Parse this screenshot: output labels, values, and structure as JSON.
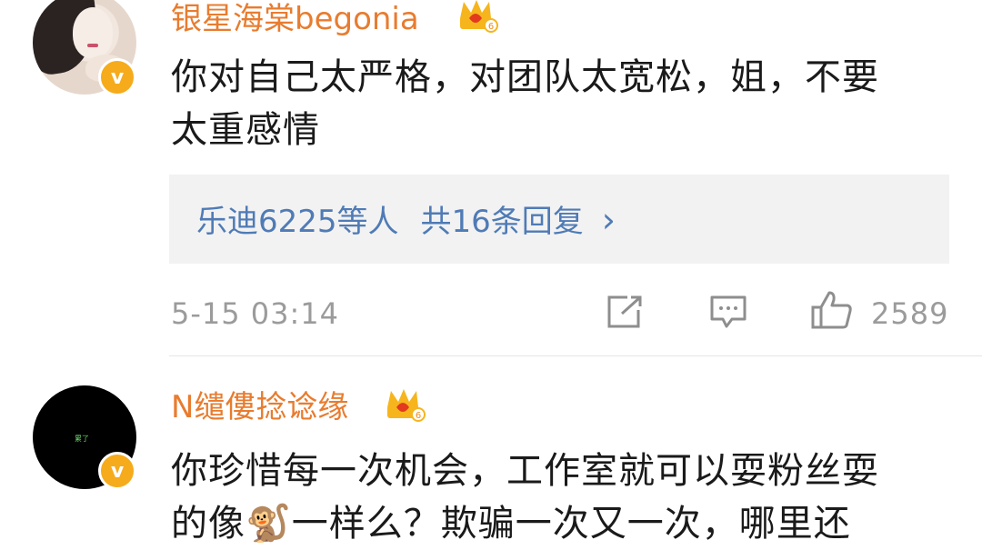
{
  "comments": [
    {
      "username": "银星海棠begonia",
      "badge_level": "6",
      "verified_mark": "v",
      "text_line1": "你对自己太严格，对团队太宽松，姐，不要",
      "text_line2": "太重感情",
      "replies": {
        "who": "乐迪6225等人",
        "count_text": "共16条回复",
        "chevron": "›"
      },
      "time": "5-15 03:14",
      "like_count": "2589"
    },
    {
      "username": "N缱僂捻谂缘",
      "badge_level": "6",
      "verified_mark": "v",
      "avatar_text": "累了",
      "text_line1": "你珍惜每一次机会，工作室就可以耍粉丝耍",
      "text_line2": "的像🐒一样么？欺骗一次又一次，哪里还"
    }
  ],
  "icons": {
    "share": "share-icon",
    "comment": "comment-icon",
    "like": "thumbs-up-icon",
    "crown": "crown-badge-icon"
  },
  "colors": {
    "username": "#e87c2f",
    "reply_link": "#4f7bb6",
    "meta_gray": "#9b9b9b",
    "verified_gold": "#f5ab1c",
    "reply_bg": "#f2f2f2"
  }
}
